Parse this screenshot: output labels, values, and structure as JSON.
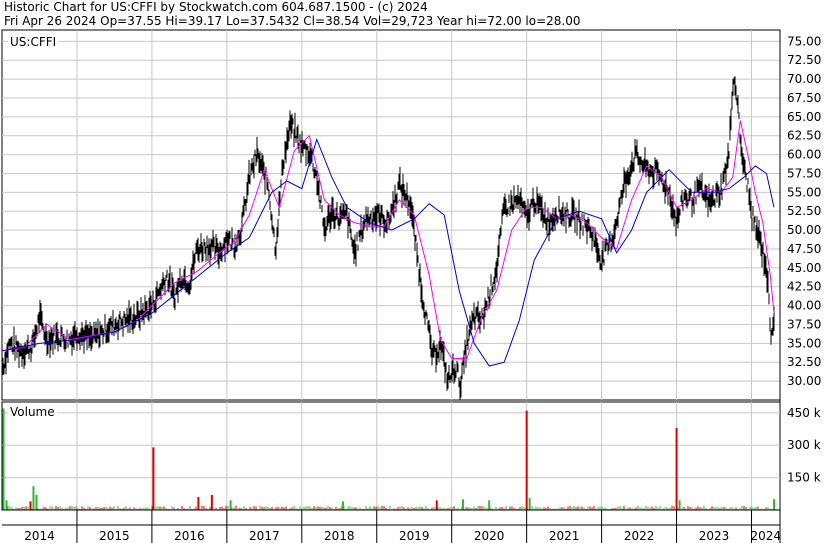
{
  "header": {
    "line1": "Historic Chart for US:CFFI by Stockwatch.com 604.687.1500 - (c) 2024",
    "line2": "Fri Apr 26 2024   Op=37.55   Hi=39.17   Lo=37.5432   Cl=38.54   Vol=29,723   Year hi=72.00   lo=28.00"
  },
  "symbol": "US:CFFI",
  "volume_title": "Volume",
  "colors": {
    "price_bars": "#000000",
    "ma_short": "#ff00ff",
    "ma_long": "#0000cc",
    "vol_up": "#2fb52f",
    "vol_down": "#dd0000",
    "grid": "#c8c8c8"
  },
  "chart_data": [
    {
      "type": "line",
      "title": "Historic Chart for US:CFFI",
      "ylim": [
        27.5,
        76.5
      ],
      "y_ticks": [
        "75.00",
        "72.50",
        "70.00",
        "67.50",
        "65.00",
        "62.50",
        "60.00",
        "57.50",
        "55.00",
        "52.50",
        "50.00",
        "47.50",
        "45.00",
        "42.50",
        "40.00",
        "37.50",
        "35.00",
        "32.50",
        "30.00"
      ],
      "x_ticks": [
        "2014",
        "2015",
        "2016",
        "2017",
        "2018",
        "2019",
        "2020",
        "2021",
        "2022",
        "2023",
        "2024"
      ],
      "xlim": [
        2014.0,
        2024.38
      ],
      "grid": true,
      "series": [
        {
          "name": "",
          "style": "price",
          "x": [
            2014.0,
            2014.1,
            2014.25,
            2014.4,
            2014.5,
            2014.6,
            2014.75,
            2014.9,
            2015.0,
            2015.2,
            2015.4,
            2015.6,
            2015.8,
            2016.0,
            2016.1,
            2016.2,
            2016.3,
            2016.4,
            2016.5,
            2016.6,
            2016.75,
            2016.9,
            2017.0,
            2017.1,
            2017.2,
            2017.3,
            2017.4,
            2017.55,
            2017.65,
            2017.75,
            2017.85,
            2018.0,
            2018.1,
            2018.2,
            2018.3,
            2018.4,
            2018.5,
            2018.6,
            2018.7,
            2018.85,
            2019.0,
            2019.15,
            2019.3,
            2019.45,
            2019.6,
            2019.75,
            2019.85,
            2019.95,
            2020.05,
            2020.12,
            2020.2,
            2020.3,
            2020.4,
            2020.5,
            2020.6,
            2020.7,
            2020.8,
            2020.9,
            2021.0,
            2021.1,
            2021.2,
            2021.3,
            2021.4,
            2021.55,
            2021.7,
            2021.85,
            2022.0,
            2022.15,
            2022.3,
            2022.45,
            2022.6,
            2022.75,
            2022.9,
            2023.0,
            2023.1,
            2023.2,
            2023.3,
            2023.45,
            2023.6,
            2023.7,
            2023.75,
            2023.8,
            2023.85,
            2023.9,
            2023.95,
            2024.0,
            2024.1,
            2024.2,
            2024.26,
            2024.3
          ],
          "values": [
            31.5,
            35.0,
            34.0,
            34.5,
            38.5,
            35.5,
            36.0,
            35.5,
            36.5,
            35.5,
            37.0,
            38.0,
            38.5,
            40.0,
            42.0,
            44.0,
            41.0,
            44.0,
            43.0,
            47.5,
            48.0,
            47.0,
            49.0,
            48.0,
            50.5,
            57.0,
            60.0,
            56.0,
            47.5,
            59.0,
            64.0,
            61.0,
            60.5,
            57.0,
            50.0,
            52.5,
            51.5,
            52.0,
            47.0,
            51.5,
            52.0,
            51.0,
            56.0,
            53.5,
            42.0,
            33.0,
            35.0,
            30.0,
            32.0,
            29.5,
            35.0,
            38.5,
            38.0,
            41.5,
            45.0,
            53.0,
            53.5,
            54.0,
            51.5,
            54.0,
            52.5,
            51.0,
            52.5,
            52.0,
            51.5,
            50.0,
            46.0,
            49.0,
            56.0,
            60.0,
            58.0,
            57.5,
            55.0,
            51.0,
            54.5,
            54.0,
            55.5,
            53.5,
            55.5,
            60.0,
            70.0,
            68.5,
            62.0,
            58.0,
            56.0,
            52.0,
            49.0,
            45.0,
            36.5,
            38.5
          ]
        },
        {
          "name": "",
          "style": "ma_short",
          "x": [
            2014.0,
            2014.3,
            2014.6,
            2014.9,
            2015.2,
            2015.5,
            2015.8,
            2016.0,
            2016.3,
            2016.6,
            2016.9,
            2017.1,
            2017.3,
            2017.5,
            2017.7,
            2017.9,
            2018.1,
            2018.3,
            2018.5,
            2018.7,
            2018.9,
            2019.1,
            2019.3,
            2019.5,
            2019.7,
            2019.85,
            2020.0,
            2020.2,
            2020.4,
            2020.6,
            2020.8,
            2021.0,
            2021.2,
            2021.4,
            2021.6,
            2021.8,
            2022.0,
            2022.2,
            2022.4,
            2022.6,
            2022.8,
            2023.0,
            2023.2,
            2023.4,
            2023.6,
            2023.75,
            2023.85,
            2023.95,
            2024.05,
            2024.15,
            2024.25,
            2024.3
          ],
          "values": [
            34.0,
            34.5,
            37.5,
            35.5,
            36.0,
            36.5,
            38.0,
            40.0,
            43.0,
            44.5,
            47.0,
            48.5,
            52.0,
            58.0,
            53.0,
            60.5,
            62.5,
            54.0,
            52.0,
            51.0,
            50.5,
            50.5,
            54.0,
            52.0,
            44.0,
            35.5,
            33.0,
            33.0,
            38.5,
            42.0,
            50.0,
            53.0,
            53.0,
            51.5,
            52.0,
            51.0,
            49.0,
            47.5,
            54.0,
            58.5,
            57.0,
            53.0,
            54.0,
            55.5,
            55.0,
            57.0,
            64.5,
            60.0,
            55.0,
            51.0,
            44.0,
            39.0
          ]
        },
        {
          "name": "",
          "style": "ma_long",
          "x": [
            2014.0,
            2014.5,
            2015.0,
            2015.5,
            2016.0,
            2016.5,
            2017.0,
            2017.3,
            2017.6,
            2017.8,
            2018.0,
            2018.2,
            2018.4,
            2018.6,
            2018.9,
            2019.2,
            2019.5,
            2019.7,
            2019.9,
            2020.1,
            2020.3,
            2020.5,
            2020.7,
            2020.9,
            2021.1,
            2021.4,
            2021.7,
            2022.0,
            2022.2,
            2022.4,
            2022.6,
            2022.9,
            2023.2,
            2023.5,
            2023.7,
            2023.9,
            2024.05,
            2024.2,
            2024.3
          ],
          "values": [
            34.0,
            35.0,
            35.5,
            36.5,
            39.0,
            43.0,
            47.0,
            49.0,
            55.0,
            56.5,
            55.5,
            62.0,
            57.0,
            53.0,
            51.0,
            50.0,
            51.5,
            53.5,
            52.0,
            42.0,
            35.0,
            32.0,
            32.5,
            38.0,
            46.0,
            51.5,
            52.5,
            51.5,
            47.0,
            50.0,
            55.0,
            58.0,
            55.0,
            55.0,
            55.5,
            57.0,
            58.5,
            57.5,
            53.0
          ]
        }
      ]
    },
    {
      "type": "bar",
      "title": "Volume",
      "ylim": [
        0,
        500000
      ],
      "y_ticks": [
        "450 k",
        "300 k",
        "150 k"
      ],
      "xlim": [
        2014.0,
        2024.38
      ],
      "spikes": [
        {
          "x": 2014.02,
          "value": 470000,
          "color": "up"
        },
        {
          "x": 2014.06,
          "value": 45000,
          "color": "up"
        },
        {
          "x": 2014.42,
          "value": 110000,
          "color": "up"
        },
        {
          "x": 2014.46,
          "value": 70000,
          "color": "up"
        },
        {
          "x": 2014.38,
          "value": 40000,
          "color": "down"
        },
        {
          "x": 2016.02,
          "value": 290000,
          "color": "down"
        },
        {
          "x": 2016.62,
          "value": 60000,
          "color": "down"
        },
        {
          "x": 2016.8,
          "value": 70000,
          "color": "down"
        },
        {
          "x": 2017.05,
          "value": 45000,
          "color": "up"
        },
        {
          "x": 2018.55,
          "value": 40000,
          "color": "up"
        },
        {
          "x": 2019.8,
          "value": 45000,
          "color": "down"
        },
        {
          "x": 2020.15,
          "value": 50000,
          "color": "up"
        },
        {
          "x": 2020.5,
          "value": 45000,
          "color": "up"
        },
        {
          "x": 2021.0,
          "value": 460000,
          "color": "down"
        },
        {
          "x": 2021.04,
          "value": 55000,
          "color": "up"
        },
        {
          "x": 2023.0,
          "value": 380000,
          "color": "down"
        },
        {
          "x": 2023.04,
          "value": 45000,
          "color": "up"
        },
        {
          "x": 2024.3,
          "value": 50000,
          "color": "up"
        }
      ]
    }
  ]
}
